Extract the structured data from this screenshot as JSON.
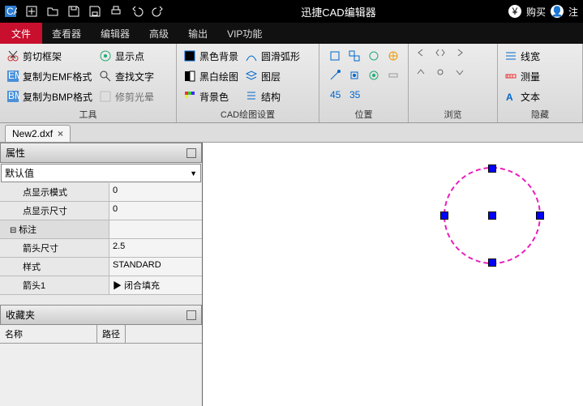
{
  "title": "迅捷CAD编辑器",
  "titlebar_right": {
    "buy": "购买",
    "login": "注"
  },
  "menu": {
    "file": "文件",
    "viewer": "查看器",
    "editor": "编辑器",
    "advanced": "高级",
    "output": "输出",
    "vip": "VIP功能"
  },
  "ribbon": {
    "tools": {
      "label": "工具",
      "clip": "剪切框架",
      "emf": "复制为EMF格式",
      "bmp": "复制为BMP格式",
      "showpt": "显示点",
      "findtxt": "查找文字",
      "trimhalo": "修剪光晕"
    },
    "cad": {
      "label": "CAD绘图设置",
      "blackbg": "黑色背景",
      "bwdraw": "黑白绘图",
      "bgcolor": "背景色",
      "smootharc": "圆滑弧形",
      "layer": "图层",
      "struct": "结构"
    },
    "pos": {
      "label": "位置"
    },
    "browse": {
      "label": "浏览"
    },
    "hide": {
      "label": "隐藏",
      "linew": "线宽",
      "measure": "测量",
      "text": "文本"
    }
  },
  "tab": {
    "name": "New2.dxf"
  },
  "props": {
    "title": "属性",
    "default": "默认值",
    "rows": [
      {
        "l": "点显示模式",
        "v": "0"
      },
      {
        "l": "点显示尺寸",
        "v": "0"
      },
      {
        "cat": true,
        "l": "标注",
        "v": ""
      },
      {
        "l": "箭头尺寸",
        "v": "2.5"
      },
      {
        "l": "样式",
        "v": "STANDARD"
      },
      {
        "l": "箭头1",
        "v": "▶ 闭合填充"
      }
    ]
  },
  "fav": {
    "title": "收藏夹",
    "col1": "名称",
    "col2": "路径"
  }
}
